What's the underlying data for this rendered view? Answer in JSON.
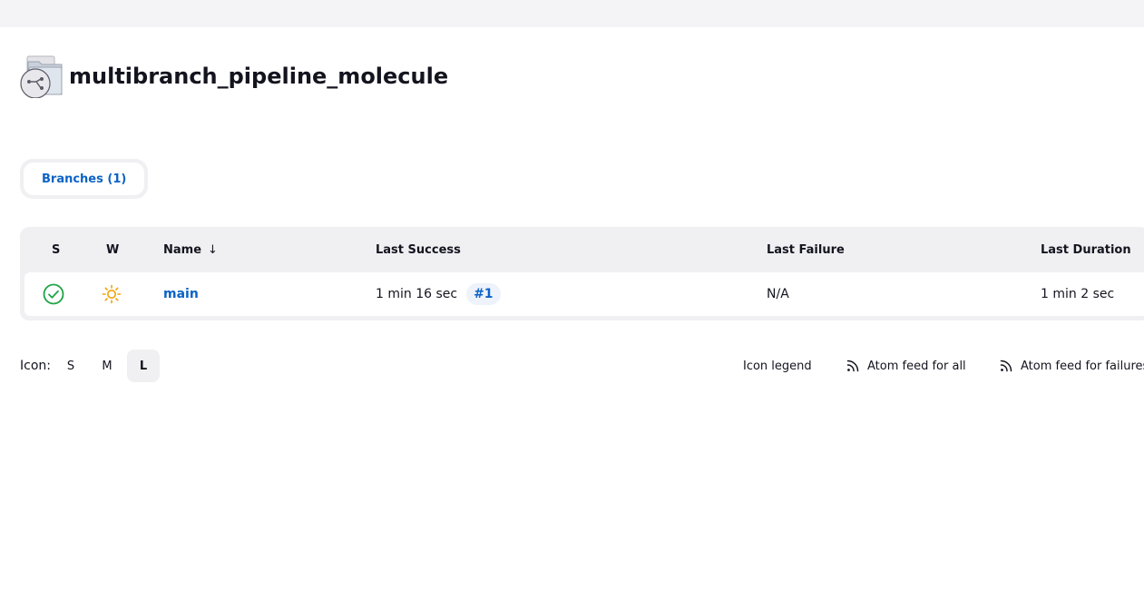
{
  "header": {
    "title": "multibranch_pipeline_molecule",
    "icon": "multibranch-folder-icon"
  },
  "tabs": [
    {
      "label": "Branches (1)",
      "active": true
    }
  ],
  "table": {
    "columns": {
      "status": "S",
      "weather": "W",
      "name": "Name",
      "name_sort": "↓",
      "last_success": "Last Success",
      "last_failure": "Last Failure",
      "last_duration": "Last Duration"
    },
    "rows": [
      {
        "status_icon": "success-check-icon",
        "weather_icon": "sunny-weather-icon",
        "name": "main",
        "last_success": "1 min 16 sec",
        "last_success_build": "#1",
        "last_failure": "N/A",
        "last_duration": "1 min 2 sec"
      }
    ]
  },
  "footer": {
    "icon_label": "Icon:",
    "sizes": [
      "S",
      "M",
      "L"
    ],
    "active_size": "L",
    "icon_legend": "Icon legend",
    "atom_all": "Atom feed for all",
    "atom_failures": "Atom feed for failures"
  },
  "colors": {
    "accent": "#0b63c6",
    "success": "#1ea446",
    "weather_sunny": "#f0a30a",
    "surface": "#f0f0f3"
  }
}
